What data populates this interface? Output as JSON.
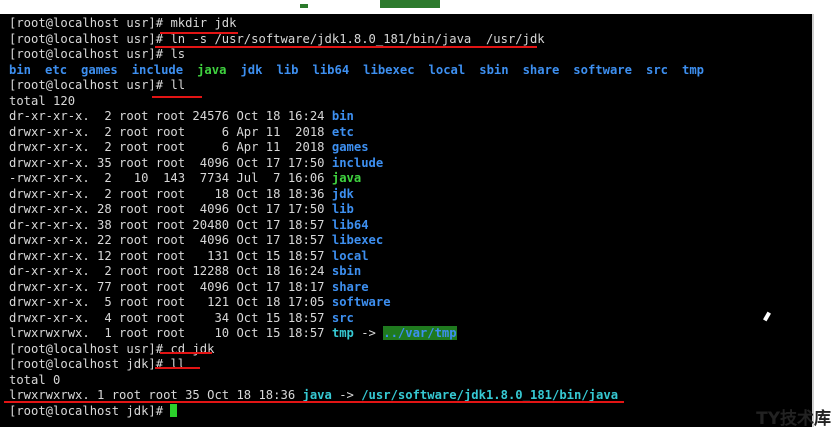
{
  "terminal": {
    "prompt_usr": "[root@localhost usr]# ",
    "prompt_jdk": "[root@localhost jdk]# ",
    "cmd_mkdir": "mkdir jdk",
    "cmd_ln": "ln -s /usr/software/jdk1.8.0_181/bin/java  /usr/jdk",
    "cmd_ls": "ls",
    "ls_items": [
      {
        "name": "bin",
        "kind": "dir"
      },
      {
        "name": "etc",
        "kind": "dir"
      },
      {
        "name": "games",
        "kind": "dir"
      },
      {
        "name": "include",
        "kind": "dir"
      },
      {
        "name": "java",
        "kind": "exe"
      },
      {
        "name": "jdk",
        "kind": "dir"
      },
      {
        "name": "lib",
        "kind": "dir"
      },
      {
        "name": "lib64",
        "kind": "dir"
      },
      {
        "name": "libexec",
        "kind": "dir"
      },
      {
        "name": "local",
        "kind": "dir"
      },
      {
        "name": "sbin",
        "kind": "dir"
      },
      {
        "name": "share",
        "kind": "dir"
      },
      {
        "name": "software",
        "kind": "dir"
      },
      {
        "name": "src",
        "kind": "dir"
      },
      {
        "name": "tmp",
        "kind": "dir"
      }
    ],
    "cmd_ll": "ll",
    "total_usr": "total 120",
    "ll_rows": [
      {
        "meta": "dr-xr-xr-x.  2 root root 24576 Oct 18 16:24 ",
        "name": "bin",
        "kind": "dir"
      },
      {
        "meta": "drwxr-xr-x.  2 root root     6 Apr 11  2018 ",
        "name": "etc",
        "kind": "dir"
      },
      {
        "meta": "drwxr-xr-x.  2 root root     6 Apr 11  2018 ",
        "name": "games",
        "kind": "dir"
      },
      {
        "meta": "drwxr-xr-x. 35 root root  4096 Oct 17 17:50 ",
        "name": "include",
        "kind": "dir"
      },
      {
        "meta": "-rwxr-xr-x.  2   10  143  7734 Jul  7 16:06 ",
        "name": "java",
        "kind": "exe"
      },
      {
        "meta": "drwxr-xr-x.  2 root root    18 Oct 18 18:36 ",
        "name": "jdk",
        "kind": "dir"
      },
      {
        "meta": "drwxr-xr-x. 28 root root  4096 Oct 17 17:50 ",
        "name": "lib",
        "kind": "dir"
      },
      {
        "meta": "dr-xr-xr-x. 38 root root 20480 Oct 17 18:57 ",
        "name": "lib64",
        "kind": "dir"
      },
      {
        "meta": "drwxr-xr-x. 22 root root  4096 Oct 17 18:57 ",
        "name": "libexec",
        "kind": "dir"
      },
      {
        "meta": "drwxr-xr-x. 12 root root   131 Oct 15 18:57 ",
        "name": "local",
        "kind": "dir"
      },
      {
        "meta": "dr-xr-xr-x.  2 root root 12288 Oct 18 16:24 ",
        "name": "sbin",
        "kind": "dir"
      },
      {
        "meta": "drwxr-xr-x. 77 root root  4096 Oct 17 18:17 ",
        "name": "share",
        "kind": "dir"
      },
      {
        "meta": "drwxr-xr-x.  5 root root   121 Oct 18 17:05 ",
        "name": "software",
        "kind": "dir"
      },
      {
        "meta": "drwxr-xr-x.  4 root root    34 Oct 15 18:57 ",
        "name": "src",
        "kind": "dir"
      }
    ],
    "tmp_row": {
      "meta": "lrwxrwxrwx.  1 root root    10 Oct 15 18:57 ",
      "name": "tmp",
      "arrow": " -> ",
      "target": "../var/tmp"
    },
    "cmd_cd": "cd jdk",
    "total_jdk": "total 0",
    "java_link": {
      "meta": "lrwxrwxrwx. 1 root root 35 Oct 18 18:36 ",
      "name": "java",
      "arrow": " -> ",
      "target": "/usr/software/jdk1.8.0_181/bin/java"
    }
  },
  "watermark": "TY技术库",
  "colors": {
    "background": "#000000",
    "text": "#d8d8d8",
    "directory": "#3d8ff0",
    "executable": "#3fd23f",
    "symlink": "#36c9d3",
    "annotation": "#e21414"
  }
}
